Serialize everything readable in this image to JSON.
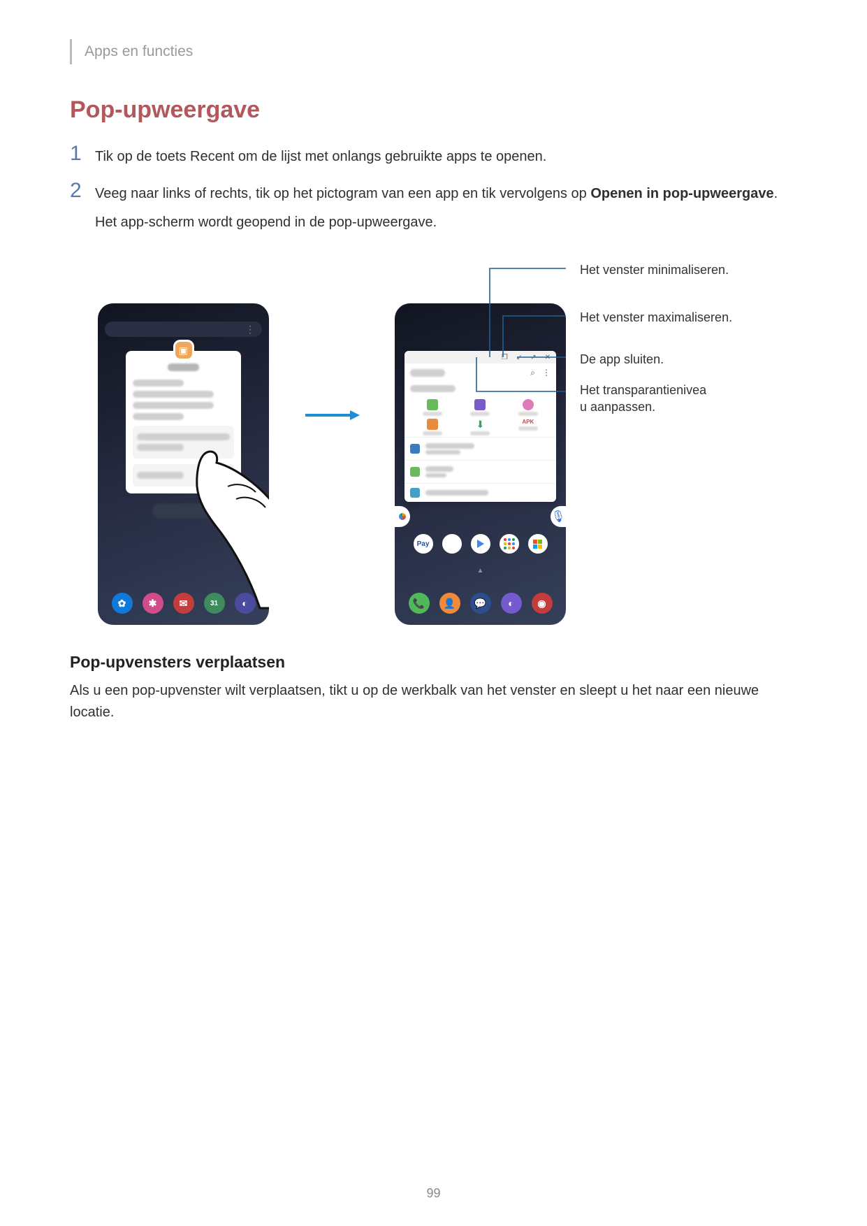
{
  "chapter": "Apps en functies",
  "title": "Pop-upweergave",
  "steps": [
    {
      "num": "1",
      "text_a": "Tik op de toets Recent om de lijst met onlangs gebruikte apps te openen.",
      "bold": "",
      "text_b": "",
      "note": ""
    },
    {
      "num": "2",
      "text_a": "Veeg naar links of rechts, tik op het pictogram van een app en tik vervolgens op ",
      "bold": "Openen in pop-upweergave",
      "text_b": ".",
      "note": "Het app-scherm wordt geopend in de pop-upweergave."
    }
  ],
  "callouts": {
    "minimize": "Het venster minimaliseren.",
    "maximize": "Het venster maximaliseren.",
    "close": "De app sluiten.",
    "opacity": "Het transparantienivea\nu aanpassen."
  },
  "popup_icons": {
    "opacity_sym": "❐",
    "minimize_sym": "↙",
    "maximize_sym": "↗",
    "close_sym": "✕",
    "search_sym": "⌕",
    "more_sym": "⋮",
    "apk_label": "APK",
    "pay_label": "Pay",
    "calendar_num": "31"
  },
  "subhead": "Pop-upvensters verplaatsen",
  "body": "Als u een pop-upvenster wilt verplaatsen, tikt u op de werkbalk van het venster en sleept u het naar een nieuwe locatie.",
  "page_number": "99"
}
